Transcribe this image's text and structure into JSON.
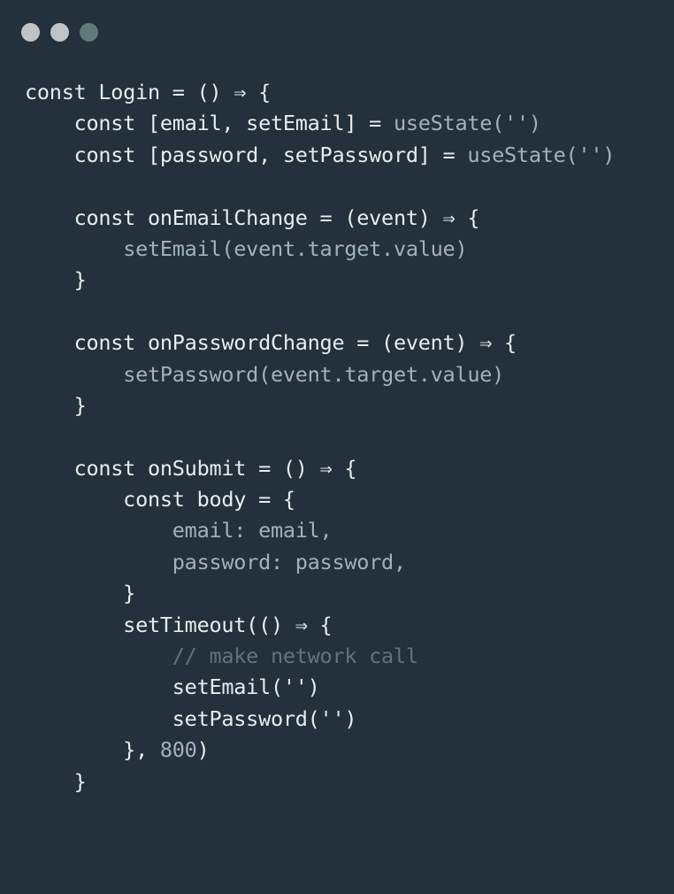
{
  "window": {
    "dots": [
      {
        "name": "dot-1",
        "color": "#bfc3c5"
      },
      {
        "name": "dot-2",
        "color": "#bfc3c5"
      },
      {
        "name": "dot-3",
        "color": "#5f7a78"
      }
    ]
  },
  "editor": {
    "lines": [
      [
        {
          "t": "const Login = () ⇒ {",
          "c": "keyword"
        }
      ],
      [
        {
          "t": "    const [email, setEmail] = ",
          "c": "keyword"
        },
        {
          "t": "useState('')",
          "c": "muted"
        }
      ],
      [
        {
          "t": "    const [password, setPassword] = ",
          "c": "keyword"
        },
        {
          "t": "useState('')",
          "c": "muted"
        }
      ],
      [],
      [
        {
          "t": "    const onEmailChange = (event) ⇒ {",
          "c": "keyword"
        }
      ],
      [
        {
          "t": "        ",
          "c": "ident"
        },
        {
          "t": "setEmail(event.target.value)",
          "c": "muted"
        }
      ],
      [
        {
          "t": "    }",
          "c": "keyword"
        }
      ],
      [],
      [
        {
          "t": "    const onPasswordChange = (event) ⇒ {",
          "c": "keyword"
        }
      ],
      [
        {
          "t": "        ",
          "c": "ident"
        },
        {
          "t": "setPassword(event.target.value)",
          "c": "muted"
        }
      ],
      [
        {
          "t": "    }",
          "c": "keyword"
        }
      ],
      [],
      [
        {
          "t": "    const onSubmit = () ⇒ {",
          "c": "keyword"
        }
      ],
      [
        {
          "t": "        const body = {",
          "c": "keyword"
        }
      ],
      [
        {
          "t": "            ",
          "c": "ident"
        },
        {
          "t": "email: email,",
          "c": "muted"
        }
      ],
      [
        {
          "t": "            ",
          "c": "ident"
        },
        {
          "t": "password: password,",
          "c": "muted"
        }
      ],
      [
        {
          "t": "        }",
          "c": "keyword"
        }
      ],
      [
        {
          "t": "        setTimeout(() ⇒ {",
          "c": "keyword"
        }
      ],
      [
        {
          "t": "            ",
          "c": "ident"
        },
        {
          "t": "// make network call",
          "c": "comment"
        }
      ],
      [
        {
          "t": "            setEmail('')",
          "c": "keyword"
        }
      ],
      [
        {
          "t": "            setPassword('')",
          "c": "keyword"
        }
      ],
      [
        {
          "t": "        }, ",
          "c": "keyword"
        },
        {
          "t": "800",
          "c": "muted"
        },
        {
          "t": ")",
          "c": "keyword"
        }
      ],
      [
        {
          "t": "    }",
          "c": "keyword"
        }
      ]
    ]
  }
}
